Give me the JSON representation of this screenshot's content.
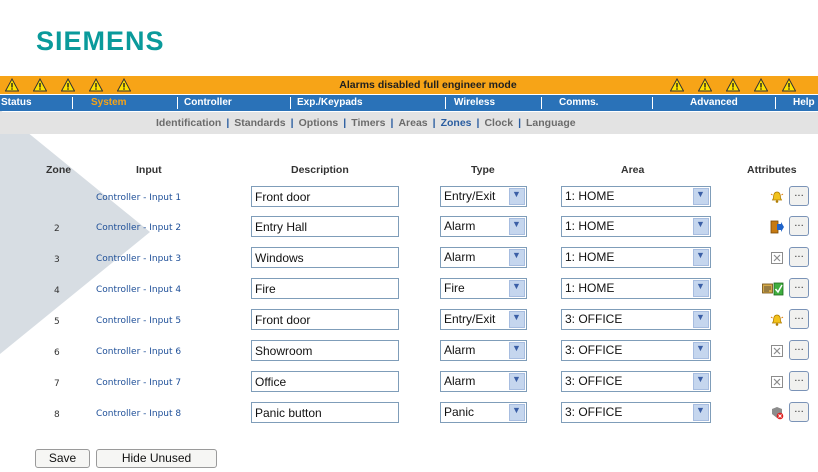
{
  "brand": "SIEMENS",
  "alarm_bar": {
    "message": "Alarms disabled full engineer mode",
    "warning_color": "#f7a417"
  },
  "nav": [
    "Status",
    "System",
    "Controller",
    "Exp./Keypads",
    "Wireless",
    "Comms.",
    "Advanced",
    "Help"
  ],
  "nav_active": "System",
  "subnav": [
    "Identification",
    "Standards",
    "Options",
    "Timers",
    "Areas",
    "Zones",
    "Clock",
    "Language"
  ],
  "subnav_active": "Zones",
  "columns": {
    "zone": "Zone",
    "input": "Input",
    "description": "Description",
    "type": "Type",
    "area": "Area",
    "attributes": "Attributes"
  },
  "rows": [
    {
      "zone": "",
      "input": "Controller - Input 1",
      "description": "Front door",
      "type": "Entry/Exit",
      "area": "1: HOME",
      "attr_icon": "chime-icon"
    },
    {
      "zone": "2",
      "input": "Controller - Input 2",
      "description": "Entry Hall",
      "type": "Alarm",
      "area": "1: HOME",
      "attr_icon": "door-exit-icon"
    },
    {
      "zone": "3",
      "input": "Controller - Input 3",
      "description": "Windows",
      "type": "Alarm",
      "area": "1: HOME",
      "attr_icon": "omit-icon"
    },
    {
      "zone": "4",
      "input": "Controller - Input 4",
      "description": "Fire",
      "type": "Fire",
      "area": "1: HOME",
      "attr_icon": "fire-test-icon"
    },
    {
      "zone": "5",
      "input": "Controller - Input 5",
      "description": "Front door",
      "type": "Entry/Exit",
      "area": "3: OFFICE",
      "attr_icon": "chime-icon"
    },
    {
      "zone": "6",
      "input": "Controller - Input 6",
      "description": "Showroom",
      "type": "Alarm",
      "area": "3: OFFICE",
      "attr_icon": "omit-icon"
    },
    {
      "zone": "7",
      "input": "Controller - Input 7",
      "description": "Office",
      "type": "Alarm",
      "area": "3: OFFICE",
      "attr_icon": "omit-icon"
    },
    {
      "zone": "8",
      "input": "Controller - Input 8",
      "description": "Panic button",
      "type": "Panic",
      "area": "3: OFFICE",
      "attr_icon": "panic-silent-icon"
    }
  ],
  "attr_button_label": "...",
  "dropdown_glyph": "▼",
  "buttons": {
    "save": "Save",
    "hide_unused": "Hide Unused"
  },
  "colors": {
    "brand": "#0a9a9b",
    "nav_bg": "#2a72b8",
    "nav_active": "#f7a417",
    "link": "#1e4f98"
  }
}
